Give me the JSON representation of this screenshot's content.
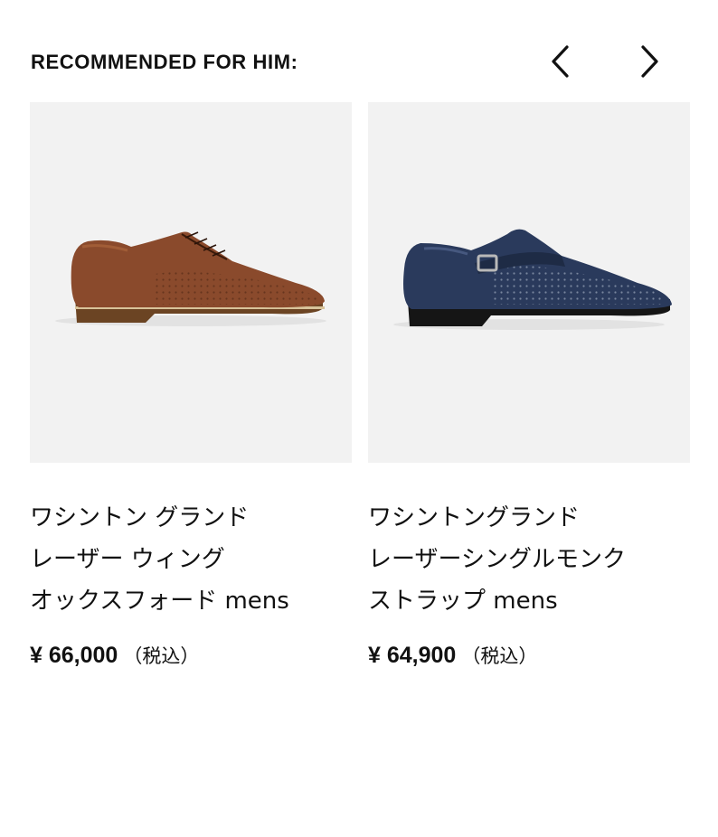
{
  "section": {
    "title": "RECOMMENDED FOR HIM:",
    "prev_icon": "chevron-left-icon",
    "next_icon": "chevron-right-icon"
  },
  "products": [
    {
      "name_lines": [
        "ワシントン グランド",
        "レーザー ウィング",
        "オックスフォード mens"
      ],
      "price": "¥ 66,000",
      "tax_note": "（税込）",
      "image": "brown-wingtip-oxford-shoe",
      "colors": {
        "leather": "#8a4a2c",
        "sole": "#5c3b22"
      }
    },
    {
      "name_lines": [
        "ワシントングランド",
        "レーザーシングルモンク",
        "ストラップ mens"
      ],
      "price": "¥ 64,900",
      "tax_note": "（税込）",
      "image": "navy-monk-strap-shoe",
      "colors": {
        "leather": "#2a3a5c",
        "sole": "#1a1a1a"
      }
    }
  ]
}
